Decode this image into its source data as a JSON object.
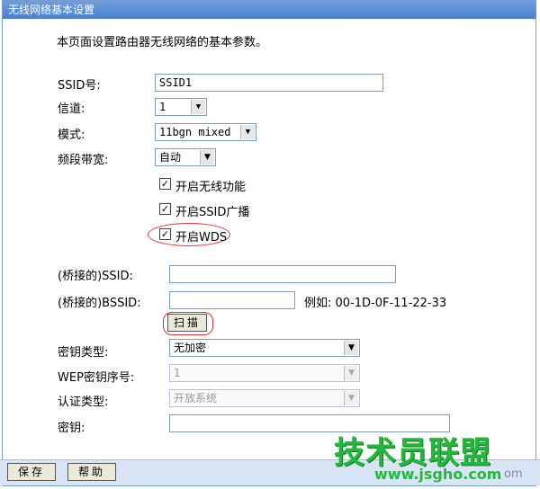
{
  "window": {
    "title": "无线网络基本设置"
  },
  "intro": "本页面设置路由器无线网络的基本参数。",
  "fields": {
    "ssid": {
      "label": "SSID号:",
      "value": "SSID1"
    },
    "channel": {
      "label": "信道:",
      "value": "1"
    },
    "mode": {
      "label": "模式:",
      "value": "11bgn mixed"
    },
    "bandwidth": {
      "label": "频段带宽:",
      "value": "自动"
    }
  },
  "checkboxes": {
    "wireless": {
      "label": "开启无线功能",
      "checked": "✓"
    },
    "ssid_broadcast": {
      "label": "开启SSID广播",
      "checked": "✓"
    },
    "wds": {
      "label": "开启WDS",
      "checked": "✓"
    }
  },
  "wds": {
    "bridged_ssid": {
      "label": "(桥接的)SSID:",
      "value": ""
    },
    "bridged_bssid": {
      "label": "(桥接的)BSSID:",
      "value": "",
      "example": "例如: 00-1D-0F-11-22-33"
    },
    "scan_button": "扫描",
    "key_type": {
      "label": "密钥类型:",
      "value": "无加密"
    },
    "wep_index": {
      "label": "WEP密钥序号:",
      "value": "1"
    },
    "auth_type": {
      "label": "认证类型:",
      "value": "开放系统"
    },
    "key": {
      "label": "密钥:",
      "value": ""
    }
  },
  "buttons": {
    "save": "保存",
    "help": "帮助"
  },
  "watermark": {
    "brand": "技术员联盟",
    "url": "www.jsgho.com",
    "extra": "om"
  },
  "colors": {
    "title_bar": "#5a8ad8",
    "watermark_green": "#22b83b",
    "highlight_red": "#dd3333"
  }
}
